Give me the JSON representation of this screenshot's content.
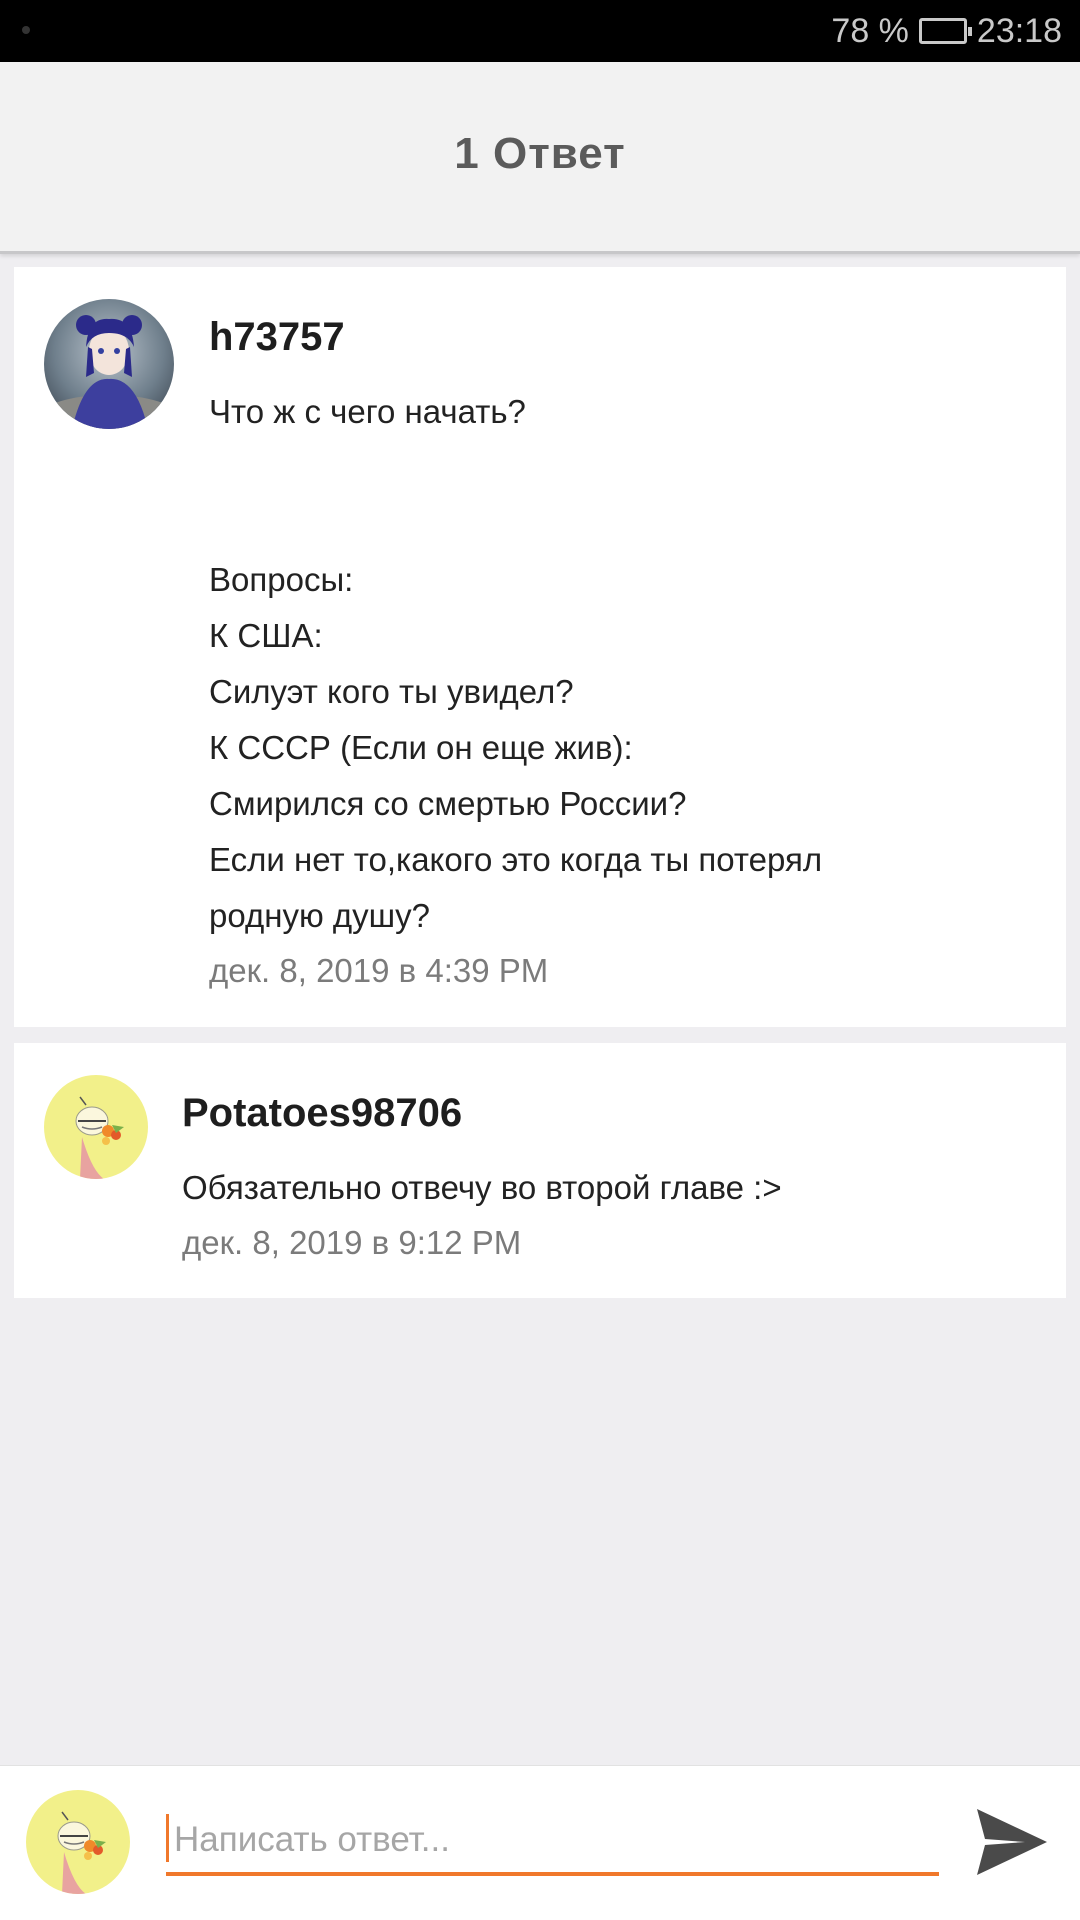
{
  "status_bar": {
    "battery": "78 %",
    "time": "23:18"
  },
  "header": {
    "title": "1 Ответ"
  },
  "comments": [
    {
      "username": "h73757",
      "text": "Что ж  с чего начать?\n\n\nВопросы:\nК США:\nСилуэт кого ты увидел?\nК СССР (Если он еще жив):\nСмирился со смертью России?\nЕсли нет то,какого это когда ты потерял\nродную душу?",
      "timestamp": "дек. 8, 2019 в 4:39 PM",
      "avatar": "anime-girl-avatar"
    },
    {
      "username": "Potatoes98706",
      "text": "Обязательно отвечу во второй главе :>",
      "timestamp": "дек. 8, 2019 в 9:12 PM",
      "avatar": "yellow-doodle-avatar"
    }
  ],
  "reply": {
    "placeholder": "Написать ответ...",
    "accent_color": "#f0782b",
    "send_icon": "send-icon"
  }
}
